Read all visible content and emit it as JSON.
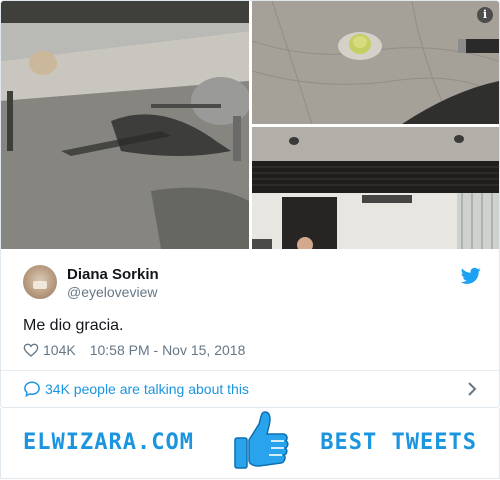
{
  "tweet": {
    "author_name": "Diana Sorkin",
    "author_handle": "@eyeloveview",
    "text": "Me dio gracia.",
    "likes": "104K",
    "timestamp": "10:58 PM - Nov 15, 2018",
    "talking": "34K people are talking about this"
  },
  "icons": {
    "info": "info-icon",
    "bird": "twitter-bird-icon",
    "heart": "heart-icon",
    "bubble": "speech-bubble-icon",
    "chevron": "chevron-right-icon",
    "thumb": "thumbs-up-icon"
  },
  "colors": {
    "accent": "#1b95e0",
    "text": "#14171a",
    "muted": "#657786"
  },
  "banner": {
    "brand": "ELWIZARA.COM",
    "tagline": "BEST TWEETS"
  }
}
